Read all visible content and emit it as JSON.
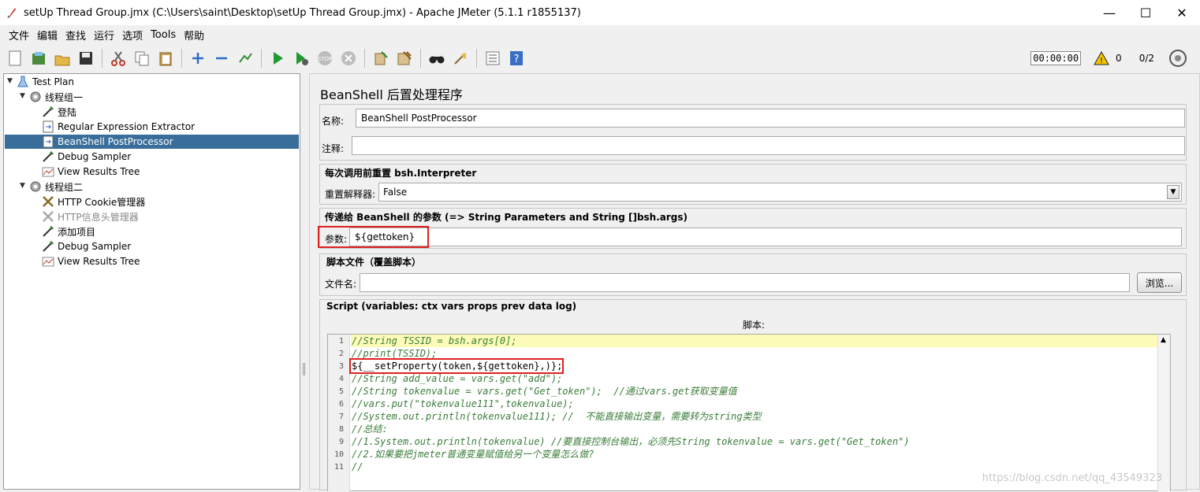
{
  "window": {
    "title": "setUp Thread Group.jmx (C:\\Users\\saint\\Desktop\\setUp Thread Group.jmx) - Apache JMeter (5.1.1 r1855137)",
    "minimize": "—",
    "maximize": "☐",
    "close": "✕"
  },
  "menu": [
    "文件",
    "编辑",
    "查找",
    "运行",
    "选项",
    "Tools",
    "帮助"
  ],
  "toolbar": {
    "timer": "00:00:00",
    "warning_count": "0",
    "thread_ratio": "0/2"
  },
  "tree": [
    {
      "label": "Test Plan",
      "icon": "test-plan-icon"
    },
    {
      "label": "线程组一",
      "icon": "gear-icon"
    },
    {
      "label": "登陆",
      "icon": "sampler-icon"
    },
    {
      "label": "Regular Expression Extractor",
      "icon": "postprocessor-icon"
    },
    {
      "label": "BeanShell PostProcessor",
      "icon": "postprocessor-icon"
    },
    {
      "label": "Debug Sampler",
      "icon": "sampler-icon"
    },
    {
      "label": "View Results Tree",
      "icon": "listener-icon"
    },
    {
      "label": "线程组二",
      "icon": "gear-icon"
    },
    {
      "label": "HTTP Cookie管理器",
      "icon": "config-icon"
    },
    {
      "label": "HTTP信息头管理器",
      "icon": "config-icon"
    },
    {
      "label": "添加项目",
      "icon": "sampler-icon"
    },
    {
      "label": "Debug Sampler",
      "icon": "sampler-icon"
    },
    {
      "label": "View Results Tree",
      "icon": "listener-icon"
    }
  ],
  "editor": {
    "title": "BeanShell 后置处理程序",
    "name_label": "名称:",
    "name_value": "BeanShell PostProcessor",
    "comment_label": "注释:",
    "comment_value": "",
    "reset_section": "每次调用前重置 bsh.Interpreter",
    "reset_label": "重置解释器:",
    "reset_value": "False",
    "params_section": "传递给 BeanShell 的参数 (=> String Parameters and String []bsh.args)",
    "params_label": "参数:",
    "params_value": "${gettoken}",
    "script_file_section": "脚本文件（覆盖脚本）",
    "filename_label": "文件名:",
    "filename_value": "",
    "browse_button": "浏览...",
    "script_section": "Script (variables: ctx vars props prev data log)",
    "script_header": "脚本:",
    "code_lines": [
      "//String TSSID = bsh.args[0];",
      "//print(TSSID);",
      "${__setProperty(token,${gettoken},)};",
      "//String add_value = vars.get(\"add\");",
      "//String tokenvalue = vars.get(\"Get_token\");  //通过vars.get获取变量值",
      "//vars.put(\"tokenvalue111\",tokenvalue);",
      "//System.out.println(tokenvalue111); //  不能直接输出变量，需要转为string类型",
      "//总结:",
      "//1.System.out.println(tokenvalue) //要直接控制台输出，必须先String tokenvalue = vars.get(\"Get_token\")",
      "//2.如果要把jmeter普通变量赋值给另一个变量怎么做?",
      "//"
    ],
    "line_numbers": [
      "1",
      "2",
      "3",
      "4",
      "5",
      "6",
      "7",
      "8",
      "9",
      "10",
      "11"
    ]
  },
  "watermark": "https://blog.csdn.net/qq_43549323"
}
